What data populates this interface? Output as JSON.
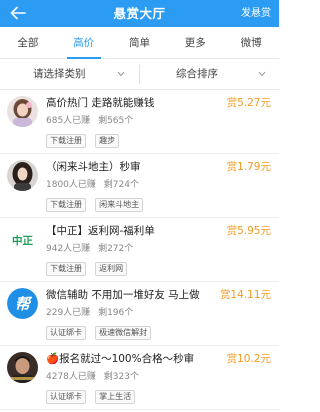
{
  "header": {
    "title": "悬赏大厅",
    "action_label": "发悬赏"
  },
  "tabs": [
    {
      "label": "全部",
      "active": false
    },
    {
      "label": "高价",
      "active": true
    },
    {
      "label": "简单",
      "active": false
    },
    {
      "label": "更多",
      "active": false
    },
    {
      "label": "微博",
      "active": false
    }
  ],
  "filters": {
    "category": "请选择类别",
    "sort": "综合排序"
  },
  "tasks": [
    {
      "title": "高价热门 走路就能赚钱",
      "done": "685人已赚",
      "remaining": "剩565个",
      "tags": [
        "下载注册",
        "趣步"
      ],
      "reward": "赏5.27元",
      "avatar": "girl-avatar"
    },
    {
      "title": "（闲来斗地主）秒审",
      "done": "1800人已赚",
      "remaining": "剩724个",
      "tags": [
        "下载注册",
        "闲来斗地主"
      ],
      "reward": "赏1.79元",
      "avatar": "woman-avatar"
    },
    {
      "title": "【中正】返利网-福利单",
      "done": "942人已赚",
      "remaining": "剩272个",
      "tags": [
        "下载注册",
        "返利网"
      ],
      "reward": "赏5.95元",
      "avatar": "logo-avatar",
      "logo_text": "中正"
    },
    {
      "title": "微信辅助  不用加一堆好友  马上做",
      "done": "229人已赚",
      "remaining": "剩196个",
      "tags": [
        "认证绑卡",
        "极速微信解封"
      ],
      "reward": "赏14.11元",
      "avatar": "bang-avatar",
      "logo_text": "帮"
    },
    {
      "title": "🍎报名就过～100%合格～秒审",
      "done": "4278人已赚",
      "remaining": "剩323个",
      "tags": [
        "认证绑卡",
        "掌上生活"
      ],
      "reward": "赏10.2元",
      "avatar": "man-avatar"
    }
  ],
  "colors": {
    "primary": "#2b9cf2",
    "reward": "#f39a1f"
  }
}
